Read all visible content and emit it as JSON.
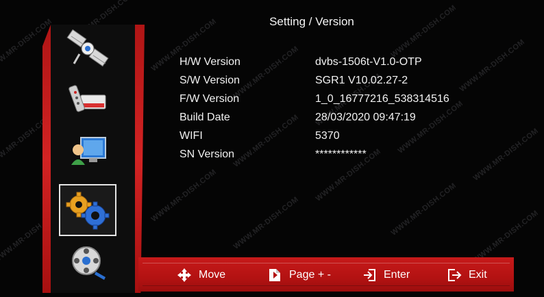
{
  "title": "Setting / Version",
  "watermark": "WWW.MR-DISH.COM",
  "menu": [
    {
      "name": "satellite-icon",
      "active": false
    },
    {
      "name": "tv-remote-icon",
      "active": false
    },
    {
      "name": "user-monitor-icon",
      "active": false
    },
    {
      "name": "settings-gears-icon",
      "active": true
    },
    {
      "name": "media-film-icon",
      "active": false
    }
  ],
  "info": [
    {
      "label": "H/W Version",
      "value": "dvbs-1506t-V1.0-OTP"
    },
    {
      "label": "S/W Version",
      "value": "SGR1 V10.02.27-2"
    },
    {
      "label": "F/W Version",
      "value": "1_0_16777216_538314516"
    },
    {
      "label": "Build Date",
      "value": "28/03/2020 09:47:19"
    },
    {
      "label": "WIFI",
      "value": "5370"
    },
    {
      "label": "SN Version",
      "value": "************"
    }
  ],
  "hints": {
    "move": "Move",
    "page": "Page + -",
    "enter": "Enter",
    "exit": "Exit"
  },
  "colors": {
    "accent": "#c71a1a",
    "background": "#050505",
    "text": "#f2f2f2"
  }
}
